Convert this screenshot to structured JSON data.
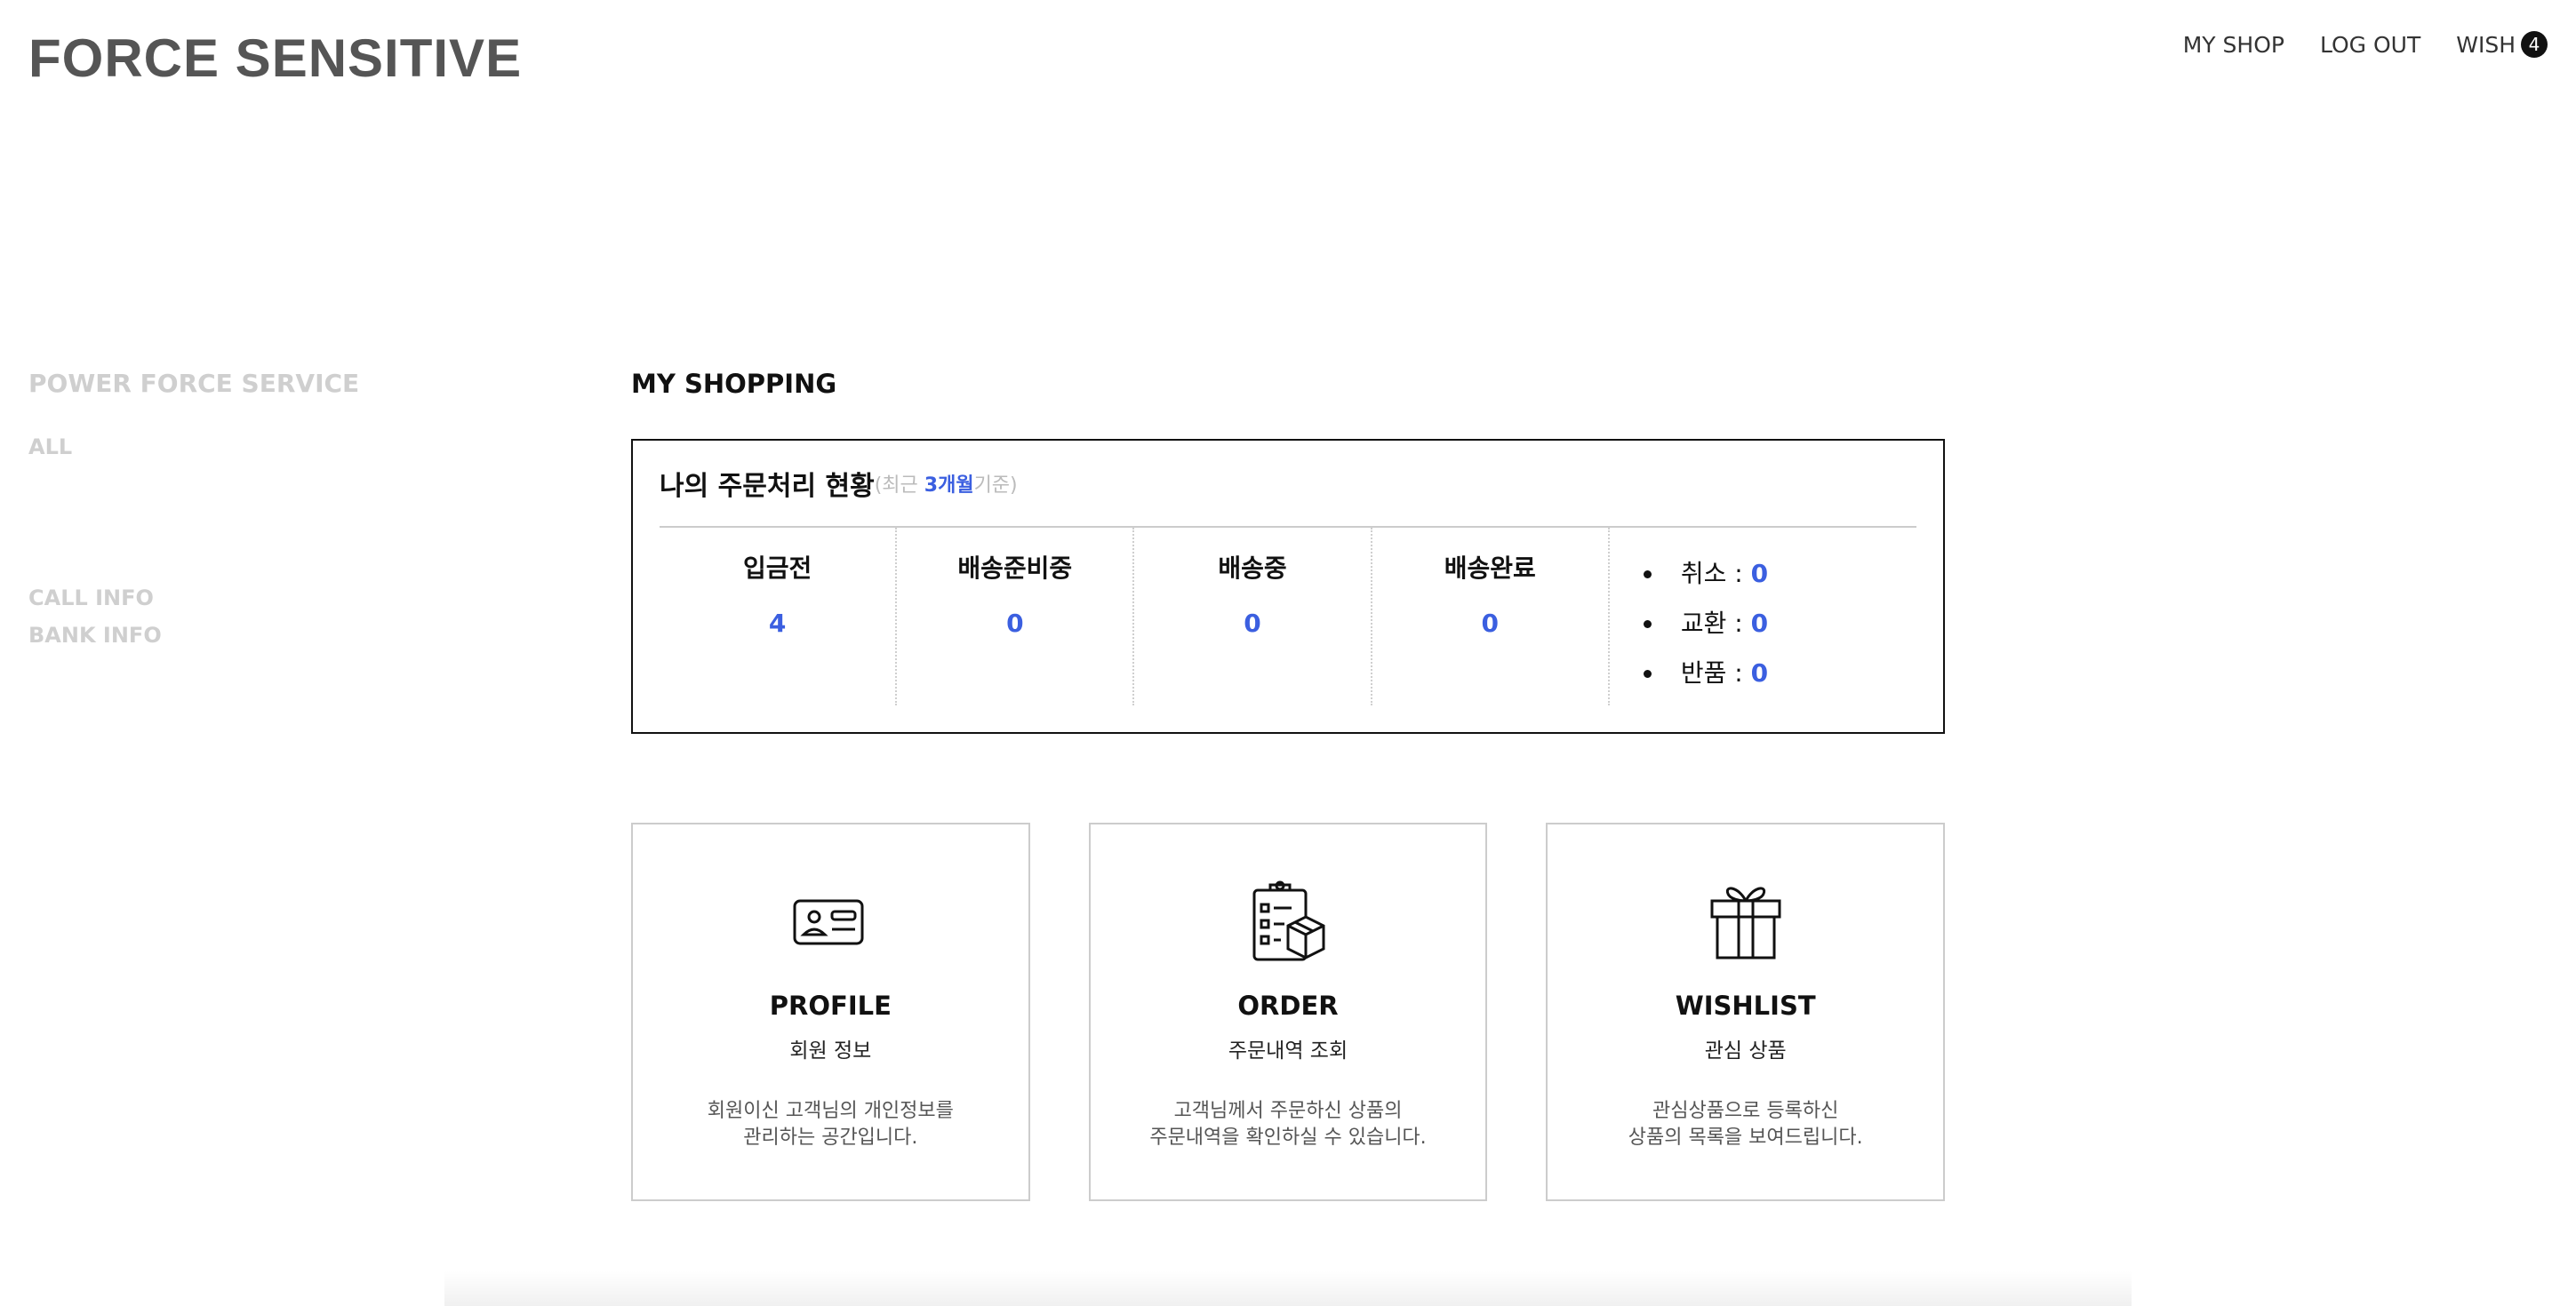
{
  "brand": {
    "logo_text": "FORCE SENSITIVE"
  },
  "top_nav": {
    "my_shop": "MY SHOP",
    "log_out": "LOG OUT",
    "wish": "WISH",
    "wish_count": "4"
  },
  "sidebar": {
    "title": "POWER FORCE SERVICE",
    "all": "ALL",
    "call_info": "CALL INFO",
    "bank_info": "BANK INFO"
  },
  "main": {
    "title": "MY SHOPPING",
    "status": {
      "title": "나의 주문처리 현황",
      "sub_prefix": "(최근 ",
      "sub_highlight": "3개월",
      "sub_suffix": "기준)",
      "columns": [
        {
          "label": "입금전",
          "count": "4"
        },
        {
          "label": "배송준비중",
          "count": "0"
        },
        {
          "label": "배송중",
          "count": "0"
        },
        {
          "label": "배송완료",
          "count": "0"
        }
      ],
      "extras": [
        {
          "label": "취소",
          "sep": " : ",
          "count": "0"
        },
        {
          "label": "교환",
          "sep": " : ",
          "count": "0"
        },
        {
          "label": "반품",
          "sep": " : ",
          "count": "0"
        }
      ]
    },
    "cards": [
      {
        "title": "PROFILE",
        "subtitle": "회원 정보",
        "desc_line1": "회원이신 고객님의 개인정보를",
        "desc_line2": "관리하는 공간입니다."
      },
      {
        "title": "ORDER",
        "subtitle": "주문내역 조회",
        "desc_line1": "고객님께서 주문하신 상품의",
        "desc_line2": "주문내역을 확인하실 수 있습니다."
      },
      {
        "title": "WISHLIST",
        "subtitle": "관심 상품",
        "desc_line1": "관심상품으로 등록하신",
        "desc_line2": "상품의 목록을 보여드립니다."
      }
    ]
  },
  "colors": {
    "accent": "#3b5fe0",
    "border": "#111111",
    "muted": "#cfcfcf"
  },
  "icons": {
    "profile": "id-card-icon",
    "order": "clipboard-box-icon",
    "wishlist": "gift-icon"
  }
}
